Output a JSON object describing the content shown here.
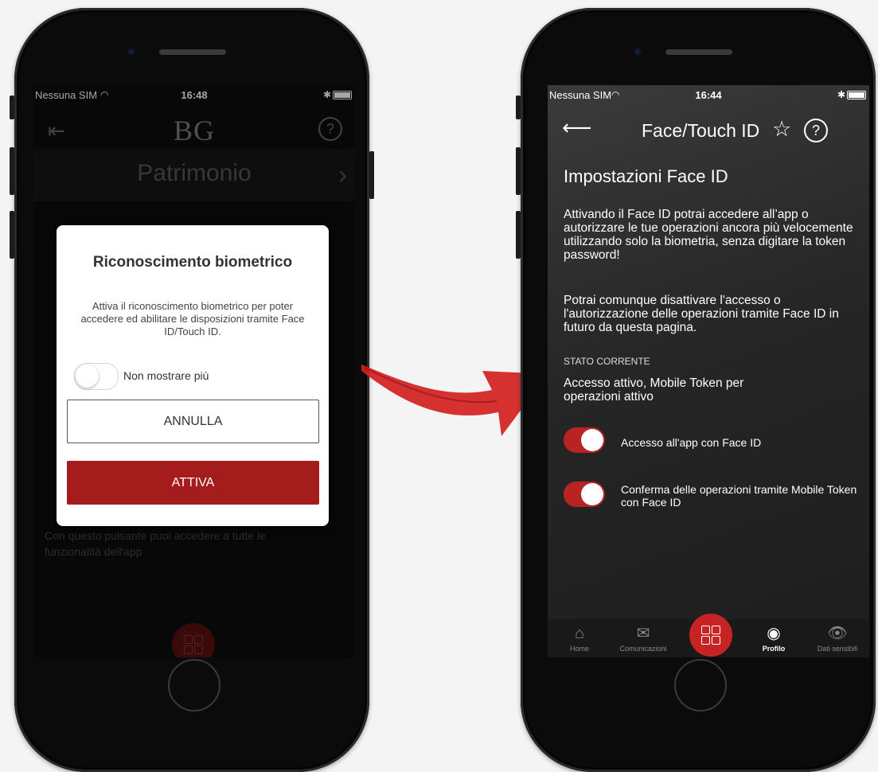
{
  "left_phone": {
    "status": {
      "carrier": "Nessuna SIM",
      "time": "16:48"
    },
    "header": {
      "logo": "BG",
      "section_title": "Patrimonio"
    },
    "body_text": "Con questo pulsante puoi accedere a tutte le funzionalità dell'app",
    "modal": {
      "title": "Riconoscimento biometrico",
      "text": "Attiva il riconoscimento biometrico per poter accedere ed abilitare le disposizioni tramite Face ID/Touch ID.",
      "toggle_label": "Non mostrare più",
      "cancel_label": "ANNULLA",
      "confirm_label": "ATTIVA"
    }
  },
  "right_phone": {
    "status": {
      "carrier": "Nessuna SIM",
      "time": "16:44"
    },
    "header": {
      "title": "Face/Touch ID"
    },
    "heading": "Impostazioni Face ID",
    "paragraph1": "Attivando il Face ID potrai accedere all’app o autorizzare le tue operazioni ancora più velocemente utilizzando solo la biometria, senza digitare la token password!",
    "paragraph2": "Potrai comunque disattivare l'accesso o l'autorizzazione delle operazioni tramite Face ID in futuro da questa pagina.",
    "state_label": "STATO CORRENTE",
    "state_value": "Accesso attivo, Mobile Token per operazioni attivo",
    "switches": [
      {
        "label": "Accesso all'app con Face ID",
        "on": true
      },
      {
        "label": "Conferma delle operazioni tramite Mobile Token con Face ID",
        "on": true
      }
    ],
    "tabs": [
      {
        "label": "Home",
        "icon": "home-icon"
      },
      {
        "label": "Comunicazioni",
        "icon": "mail-icon"
      },
      {
        "label": "Profilo",
        "icon": "profile-icon",
        "active": true
      },
      {
        "label": "Dati sensibili",
        "icon": "eye-icon"
      }
    ]
  },
  "colors": {
    "brand_red": "#a41c1c",
    "switch_red": "#b82424"
  }
}
